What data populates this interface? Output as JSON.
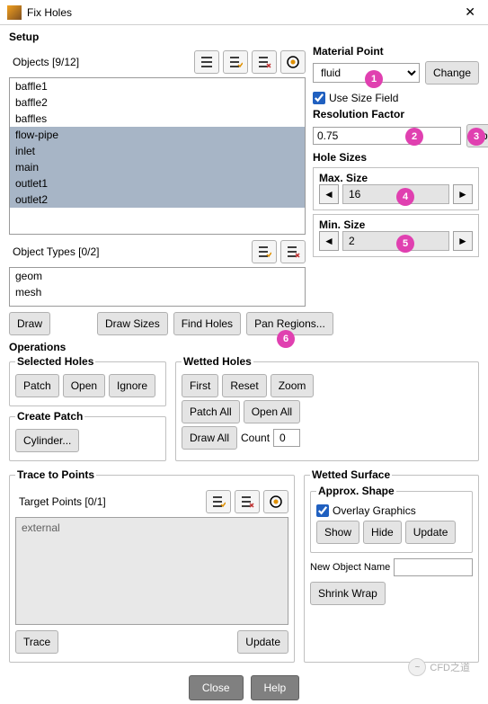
{
  "title": "Fix Holes",
  "setup": {
    "legend": "Setup",
    "objects_label": "Objects [9/12]",
    "objects": [
      "baffle1",
      "baffle2",
      "baffles",
      "flow-pipe",
      "inlet",
      "main",
      "outlet1",
      "outlet2"
    ],
    "types_label": "Object Types [0/2]",
    "types": [
      "geom",
      "mesh"
    ],
    "material_point": {
      "label": "Material Point",
      "value": "fluid",
      "change": "Change"
    },
    "use_size_field": "Use Size Field",
    "resolution": {
      "label": "Resolution Factor",
      "value": "0.75",
      "apply": "Apply"
    },
    "hole_sizes": {
      "label": "Hole Sizes",
      "max_label": "Max. Size",
      "max_value": "16",
      "min_label": "Min. Size",
      "min_value": "2"
    },
    "buttons": {
      "draw": "Draw",
      "draw_sizes": "Draw Sizes",
      "find_holes": "Find Holes",
      "pan_regions": "Pan Regions..."
    }
  },
  "operations": {
    "legend": "Operations",
    "selected": {
      "legend": "Selected Holes",
      "patch": "Patch",
      "open": "Open",
      "ignore": "Ignore"
    },
    "create_patch": {
      "legend": "Create Patch",
      "cylinder": "Cylinder..."
    },
    "wetted": {
      "legend": "Wetted Holes",
      "first": "First",
      "reset": "Reset",
      "zoom": "Zoom",
      "patch_all": "Patch All",
      "open_all": "Open All",
      "draw_all": "Draw All",
      "count_label": "Count",
      "count_value": "0"
    }
  },
  "trace": {
    "legend": "Trace to Points",
    "target_label": "Target Points [0/1]",
    "target_items": [
      "external"
    ],
    "trace": "Trace",
    "update": "Update"
  },
  "wetted_surface": {
    "legend": "Wetted Surface",
    "approx": {
      "legend": "Approx. Shape",
      "overlay": "Overlay Graphics",
      "show": "Show",
      "hide": "Hide",
      "update": "Update"
    },
    "new_obj_label": "New Object Name",
    "shrink_wrap": "Shrink Wrap"
  },
  "footer": {
    "close": "Close",
    "help": "Help"
  },
  "watermark": "CFD之道",
  "badges": [
    "1",
    "2",
    "3",
    "4",
    "5",
    "6"
  ]
}
